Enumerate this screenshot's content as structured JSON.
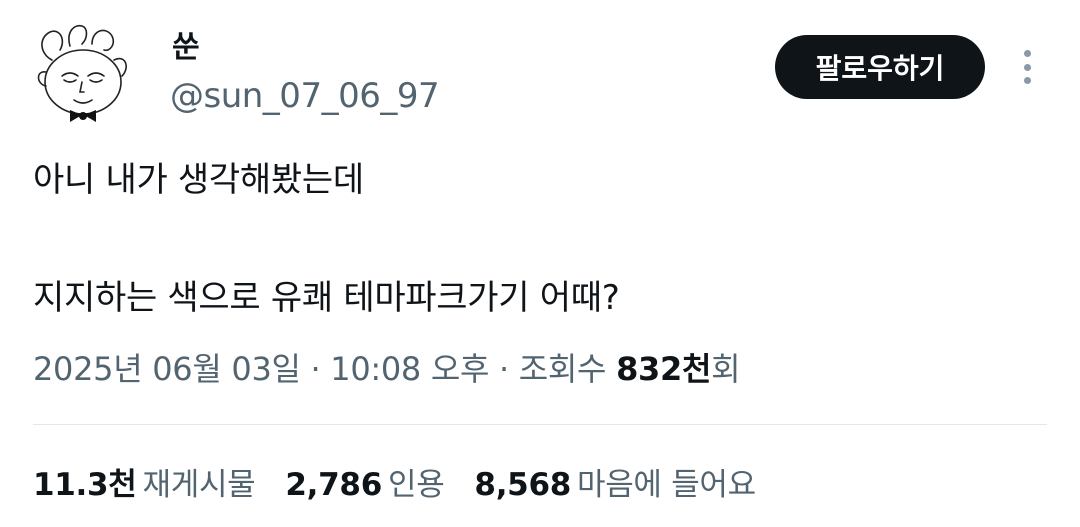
{
  "author": {
    "display_name": "쑨",
    "handle": "@sun_07_06_97",
    "avatar_icon": "cartoon-face-bowtie-avatar"
  },
  "actions": {
    "follow_label": "팔로우하기",
    "more_icon": "vertical-ellipsis-icon"
  },
  "tweet": {
    "line1": "아니 내가 생각해봤는데",
    "line2": "지지하는 색으로 유쾌 테마파크가기 어때?"
  },
  "meta": {
    "date": "2025년 06월 03일",
    "sep1": " · ",
    "time": "10:08 오후",
    "sep2": " · ",
    "views_label": "조회수 ",
    "views_count": "832천",
    "views_suffix": "회"
  },
  "stats": {
    "reposts_count": "11.3천",
    "reposts_label": "재게시물",
    "quotes_count": "2,786",
    "quotes_label": "인용",
    "likes_count": "8,568",
    "likes_label": "마음에 들어요"
  },
  "colors": {
    "text_primary": "#0f1419",
    "text_secondary": "#536471",
    "button_bg": "#0f1419",
    "divider": "#e4e8eb"
  }
}
